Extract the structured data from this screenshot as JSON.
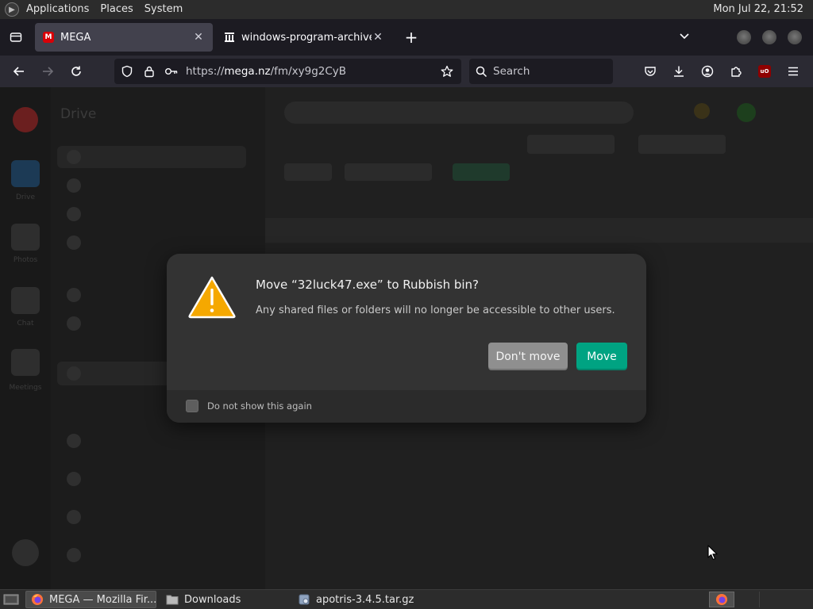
{
  "top_panel": {
    "menus": [
      "Applications",
      "Places",
      "System"
    ],
    "clock": "Mon Jul 22, 21:52"
  },
  "browser": {
    "tabs": [
      {
        "title": "MEGA",
        "active": true
      },
      {
        "title": "windows-program-archive",
        "active": false
      }
    ],
    "url": {
      "scheme": "https://",
      "host": "mega.nz",
      "path": "/fm/xy9g2CyB"
    },
    "search_placeholder": "Search"
  },
  "page_sidebar": {
    "title": "Drive",
    "rail": [
      "Drive",
      "Photos",
      "Chat",
      "Meetings"
    ]
  },
  "dialog": {
    "title": "Move “32luck47.exe” to Rubbish bin?",
    "message": "Any shared files or folders will no longer be accessible to other users.",
    "secondary_button": "Don't move",
    "primary_button": "Move",
    "checkbox_label": "Do not show this again",
    "checkbox_checked": false
  },
  "taskbar": {
    "tasks": [
      {
        "label": "MEGA — Mozilla Fir...",
        "active": true,
        "icon": "firefox-icon"
      },
      {
        "label": "Downloads",
        "active": false,
        "icon": "folder-icon"
      },
      {
        "label": "apotris-3.4.5.tar.gz",
        "active": false,
        "icon": "archive-icon"
      }
    ]
  },
  "colors": {
    "primary_button": "#00a382",
    "secondary_button": "#8f8f8f",
    "dialog_bg": "#333333",
    "warning": "#f5a800"
  }
}
